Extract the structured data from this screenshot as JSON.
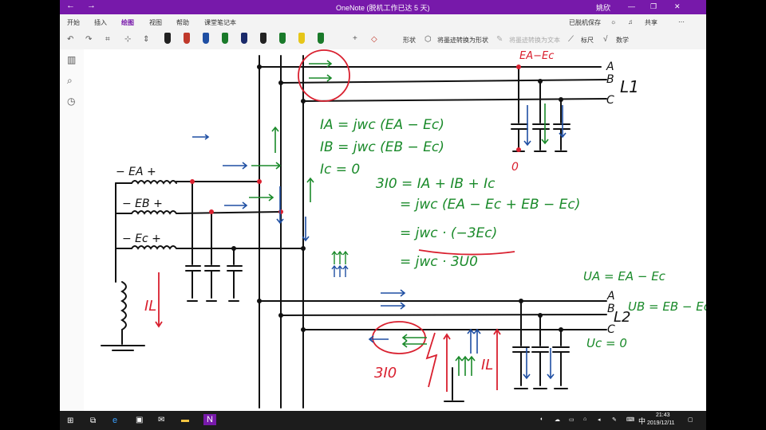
{
  "titlebar": {
    "title": "OneNote (脱机工作已达 5 天)",
    "user": "姚欣",
    "back_icon": "arrow-left-icon",
    "forward_icon": "arrow-right-icon"
  },
  "tabs": [
    "开始",
    "插入",
    "绘图",
    "视图",
    "帮助",
    "课堂笔记本"
  ],
  "active_tab": "绘图",
  "status": {
    "saved": "已脱机保存",
    "share": "共享"
  },
  "toolbar": {
    "shapes": "形状",
    "ink_to_shape": "将墨迹转换为形状",
    "ink_to_text": "将墨迹转换为文本",
    "ruler": "标尺",
    "math": "数学",
    "pen_colors": [
      "#222222",
      "#c0392b",
      "#1f4fa3",
      "#1a7a2a",
      "#1a2a6a",
      "#222222",
      "#1a7a2a",
      "#e6c619",
      "#1a7a2a"
    ]
  },
  "taskbar": {
    "ime": "中",
    "time": "21:43",
    "date": "2019/12/11"
  },
  "notes": {
    "EA": "− EA +",
    "EB": "− EB +",
    "EC": "− Ec +",
    "IL_left": "IL",
    "IL_right": "IL",
    "top_label": "EA−Ec",
    "zero": "0",
    "A1": "A",
    "B1": "B",
    "C1": "C",
    "L1": "L1",
    "A2": "A",
    "B2": "B",
    "C2": "C",
    "L2": "L2",
    "eq1": "IA = jwc (EA − Ec)",
    "eq2": "IB = jwc (EB − Ec)",
    "eq3": "Ic = 0",
    "eq4": "3I0 = IA + IB + Ic",
    "eq5": "= jwc (EA − Ec + EB − Ec)",
    "eq6": "= jwc · (−3Ec)",
    "eq7": "= jwc · 3U0",
    "ua": "UA = EA − Ec",
    "ub": "UB = EB − Ec",
    "uc": "Uc = 0",
    "i30": "3I0"
  }
}
